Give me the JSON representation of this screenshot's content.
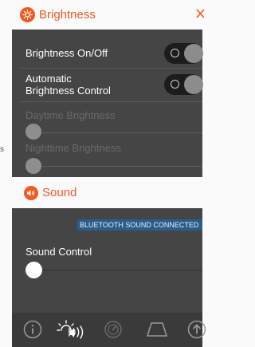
{
  "edge_mark": "s",
  "brightness": {
    "title": "Brightness",
    "close_icon": "x-close-icon",
    "rows": {
      "onoff_label": "Brightness On/Off",
      "auto_label_line1": "Automatic",
      "auto_label_line2": "Brightness Control",
      "daytime_label": "Daytime Brightness",
      "nighttime_label": "Nighttime Brightness"
    },
    "toggles": {
      "onoff": "off",
      "auto": "off"
    }
  },
  "sound": {
    "title": "Sound",
    "banner": "BLUETOOTH SOUND CONNECTED",
    "control_label": "Sound Control",
    "level": 0
  },
  "tabs": [
    "info-icon",
    "brightness-sound-icon",
    "gauge-icon",
    "trapezoid-icon",
    "upload-icon"
  ],
  "colors": {
    "accent": "#f05a22",
    "panel": "#454545",
    "tabbar": "#3a3a3a",
    "banner": "#2b5d8a"
  }
}
